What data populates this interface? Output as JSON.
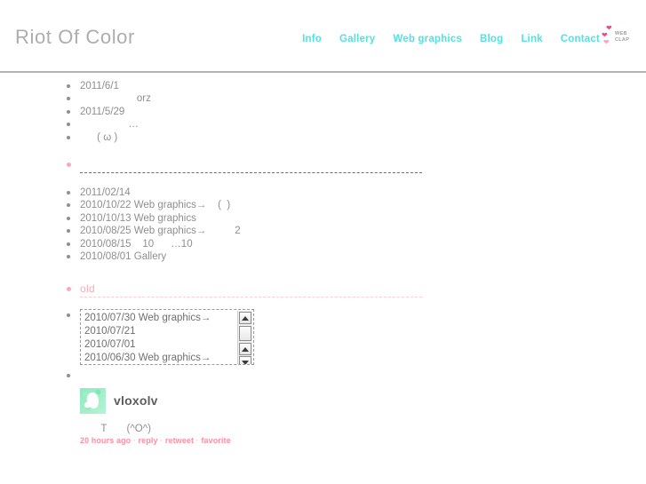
{
  "site": {
    "title": "Riot Of Color"
  },
  "nav": {
    "items": [
      {
        "label": "Info"
      },
      {
        "label": "Gallery"
      },
      {
        "label": "Web graphics"
      },
      {
        "label": "Blog"
      },
      {
        "label": "Link"
      },
      {
        "label": "Contact"
      }
    ],
    "webclap": {
      "icon": "heart-icon",
      "line1": "WEB",
      "line2": "CLAP"
    }
  },
  "news_recent": [
    {
      "text": "2011/6/1"
    },
    {
      "text": "                    orz"
    },
    {
      "text": "2011/5/29"
    },
    {
      "text": "                 …"
    },
    {
      "text": "      ( ω )"
    }
  ],
  "separator": {
    "bullet": "pink-bullet"
  },
  "news_archive": [
    {
      "text": "2011/02/14"
    },
    {
      "text": "2010/10/22 Web graphics→    (  )"
    },
    {
      "text": "2010/10/13 Web graphics"
    },
    {
      "text": "2010/08/25 Web graphics→          2"
    },
    {
      "text": "2010/08/15    10      …10"
    },
    {
      "text": "2010/08/01 Gallery"
    }
  ],
  "old_section": {
    "heading": "old",
    "scrollbox": {
      "items": [
        {
          "text": "2010/07/30 Web graphics→"
        },
        {
          "text": "2010/07/21"
        },
        {
          "text": "2010/07/01"
        },
        {
          "text": "2010/06/30 Web graphics→"
        }
      ],
      "scrollbar": {
        "up_arrow": "▲",
        "down_arrow": "▼"
      }
    }
  },
  "tweet": {
    "username": "vloxolv",
    "avatar": "bird-avatar",
    "body": "   T       (^O^)",
    "timestamp": "20 hours ago",
    "sep": " · ",
    "actions": [
      {
        "label": "reply"
      },
      {
        "label": "retweet"
      },
      {
        "label": "favorite"
      }
    ]
  },
  "colors": {
    "nav_link": "#4fe3e0",
    "title_gray": "#adadad",
    "pink": "#ffa8b4",
    "tweet_link": "#ff8fa2",
    "text_gray": "#8f8f8f"
  }
}
